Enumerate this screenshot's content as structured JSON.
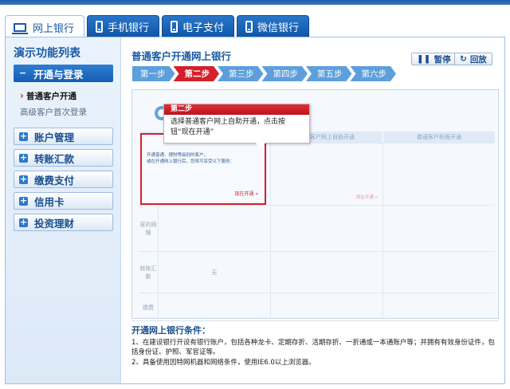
{
  "tabs": [
    {
      "label": "网上银行",
      "icon": "monitor-icon",
      "active": true
    },
    {
      "label": "手机银行",
      "icon": "phone-icon",
      "active": false
    },
    {
      "label": "电子支付",
      "icon": "phone-icon",
      "active": false
    },
    {
      "label": "微信银行",
      "icon": "phone-icon",
      "active": false
    }
  ],
  "sidebar": {
    "title": "演示功能列表",
    "open_group": {
      "label": "开通与登录",
      "sign": "−"
    },
    "sub_items": [
      {
        "label": "普通客户开通",
        "active": true
      },
      {
        "label": "高级客户首次登录",
        "active": false
      }
    ],
    "groups": [
      {
        "label": "账户管理",
        "sign": "+"
      },
      {
        "label": "转账汇款",
        "sign": "+"
      },
      {
        "label": "缴费支付",
        "sign": "+"
      },
      {
        "label": "信用卡",
        "sign": "+"
      },
      {
        "label": "投资理财",
        "sign": "+"
      }
    ]
  },
  "main": {
    "title": "普通客户开通网上银行",
    "pause_label": "暂停",
    "back_label": "回放",
    "steps": [
      "第一步",
      "第二步",
      "第三步",
      "第四步",
      "第五步",
      "第六步"
    ],
    "active_step": 1
  },
  "demo": {
    "grid_heads": [
      "",
      "普通客户网上自助开通",
      "普通客户柜面开通"
    ],
    "row_labels": [
      "",
      "客的网银",
      "转账汇款",
      "缴费"
    ],
    "highlight_text": "开通普通、理财等级别的客户，<br>或在开通网上银行后，您将可享受以下服务：",
    "highlight_button": "现在开通 »",
    "cell_right_button": "现在开通 »",
    "middle_cell": "无",
    "callout_title": "第二步",
    "callout_body": "选择普通客户网上自助开通，点击按钮“现在开通”"
  },
  "conditions": {
    "title": "开通网上银行条件：",
    "items": [
      "1、在建设银行开设有银行账户，包括各种龙卡、定期存折、活期存折、一折通或一本通账户等；并拥有有效身份证件，包括身份证、护照、军官证等。",
      "2、具备使用因特网机器和网络条件，使用IE6.0以上浏览器。"
    ]
  },
  "colors": {
    "brand_blue": "#1a5aa3",
    "accent_red": "#d4202a"
  }
}
